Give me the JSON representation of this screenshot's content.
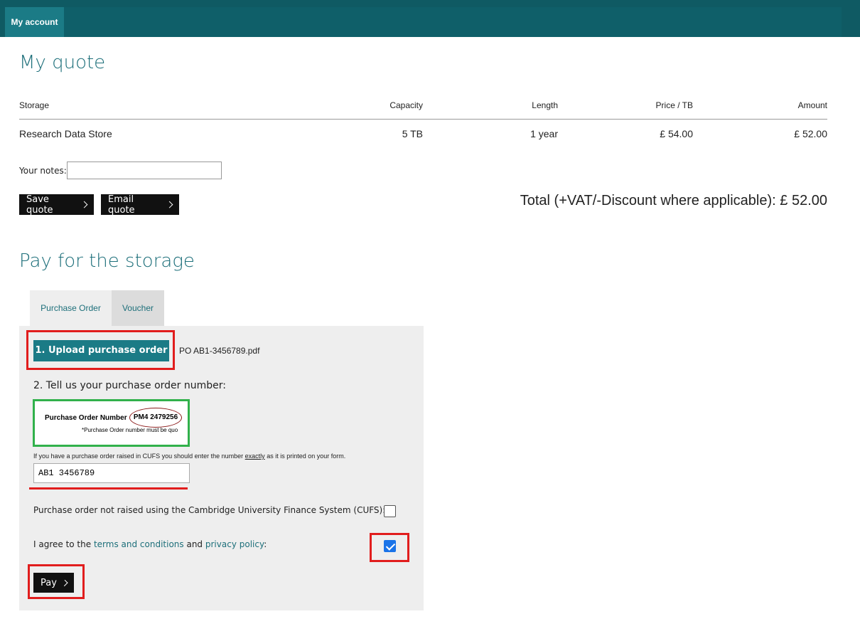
{
  "nav": {
    "account_tab": "My account"
  },
  "quote": {
    "title": "My quote",
    "columns": [
      "Storage",
      "Capacity",
      "Length",
      "Price / TB",
      "Amount"
    ],
    "row": [
      "Research Data Store",
      "5 TB",
      "1 year",
      "£ 54.00",
      "£ 52.00"
    ],
    "notes_label": "Your notes:",
    "notes_value": "",
    "save_label": "Save quote",
    "email_label": "Email quote",
    "total": "Total (+VAT/-Discount where applicable): £ 52.00"
  },
  "pay": {
    "title": "Pay for the storage",
    "tabs": [
      "Purchase Order",
      "Voucher"
    ],
    "upload_label": "1. Upload purchase order",
    "filename": "PO AB1-3456789.pdf",
    "step2": "2. Tell us your purchase order number:",
    "example_label": "Purchase Order Number",
    "example_number": "PM4 2479256",
    "example_note": "*Purchase Order number must be quo",
    "hint_before": "If you have a purchase order raised in CUFS you should enter the number ",
    "hint_emph": "exactly",
    "hint_after": " as it is printed on your form.",
    "po_value": "AB1 3456789",
    "not_cufs_label": "Purchase order not raised using the Cambridge University Finance System (CUFS):",
    "not_cufs_checked": false,
    "agree_prefix": "I agree to the ",
    "terms_link": "terms and conditions",
    "agree_and": " and ",
    "privacy_link": "privacy policy",
    "agree_suffix": ":",
    "agree_checked": true,
    "pay_label": "Pay"
  },
  "colors": {
    "brand": "#0f5a63",
    "accent": "#1b7b86",
    "highlight_red": "#e11d1d",
    "highlight_green": "#31b14b"
  }
}
